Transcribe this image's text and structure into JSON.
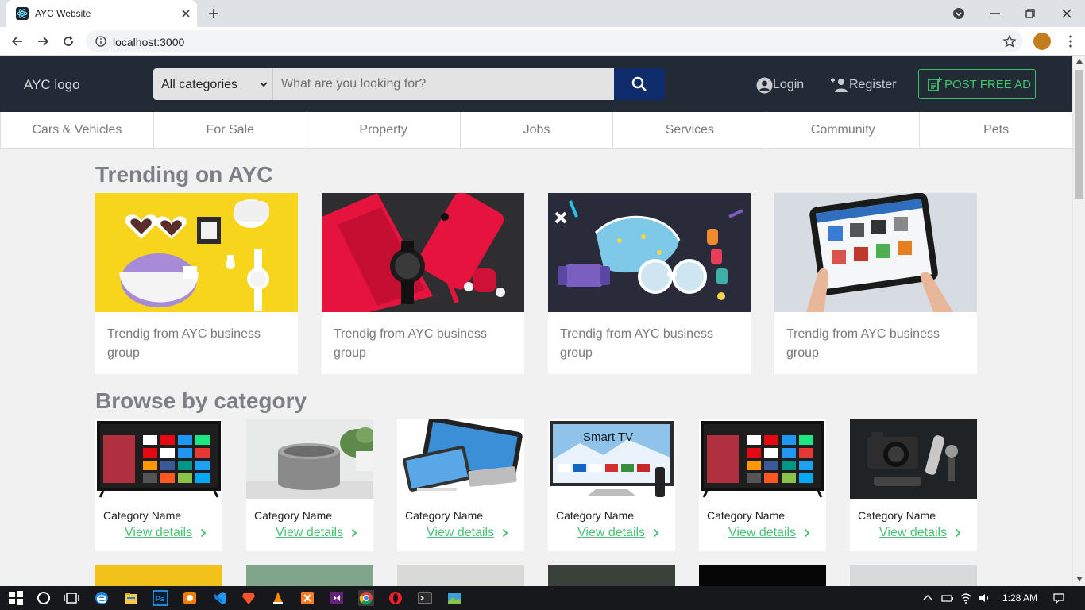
{
  "browser": {
    "tab_title": "AYC Website",
    "url": "localhost:3000"
  },
  "header": {
    "logo": "AYC logo",
    "category_select": "All categories",
    "search_placeholder": "What are you looking for?",
    "login": "Login",
    "register": "Register",
    "post_ad": "POST FREE AD"
  },
  "nav": [
    "Cars & Vehicles",
    "For Sale",
    "Property",
    "Jobs",
    "Services",
    "Community",
    "Pets"
  ],
  "trending": {
    "title": "Trending on AYC",
    "items": [
      {
        "text": "Trendig from AYC business group",
        "image": "sunglasses-purse-flatlay"
      },
      {
        "text": "Trendig from AYC business group",
        "image": "red-phone-watch-flatlay"
      },
      {
        "text": "Trendig from AYC business group",
        "image": "mask-glasses-illustration"
      },
      {
        "text": "Trendig from AYC business group",
        "image": "tablet-online-shop"
      }
    ]
  },
  "browse": {
    "title": "Browse by category",
    "items": [
      {
        "name": "Category Name",
        "link": "View details",
        "image": "smart-tv"
      },
      {
        "name": "Category Name",
        "link": "View details",
        "image": "speaker"
      },
      {
        "name": "Category Name",
        "link": "View details",
        "image": "tablets-phones"
      },
      {
        "name": "Category Name",
        "link": "View details",
        "image": "smart-tv-label",
        "overlay": "Smart TV"
      },
      {
        "name": "Category Name",
        "link": "View details",
        "image": "smart-tv"
      },
      {
        "name": "Category Name",
        "link": "View details",
        "image": "camera-gear"
      }
    ]
  },
  "taskbar": {
    "time": "1:28 AM"
  },
  "colors": {
    "header_bg": "#222a35",
    "search_button": "#0e2c6b",
    "accent_green": "#43c56f"
  }
}
